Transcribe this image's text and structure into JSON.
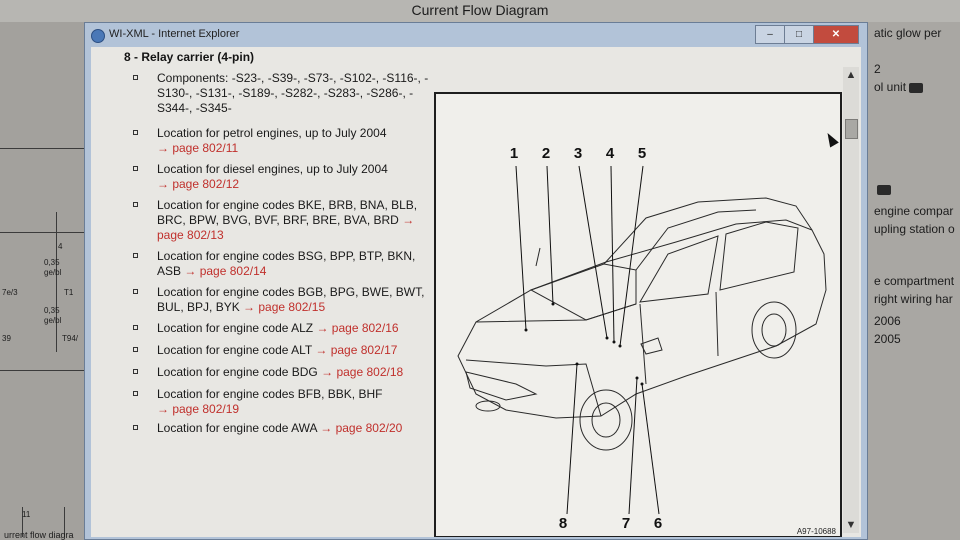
{
  "background_app": {
    "title": "Current Flow Diagram",
    "right_texts": [
      "atic glow per",
      "2",
      "ol unit",
      "engine compar",
      "upling station o",
      "e compartment",
      "right wiring har",
      "2006",
      "2005"
    ],
    "left_texts": [
      "4",
      "0,35",
      "ge/bl",
      "T1",
      "0,35",
      "ge/bl",
      "T94/",
      "7e/3",
      "39",
      "11",
      "urrent flow diagra"
    ]
  },
  "window": {
    "title": "WI-XML - Internet Explorer",
    "controls": {
      "minimize": "–",
      "maximize": "□",
      "close": "✕"
    }
  },
  "doc": {
    "heading": "8 - Relay carrier (4-pin)",
    "items": [
      {
        "text": "Components: -S23-, -S39-, -S73-, -S102-, -S116-, -S130-, -S131-, -S189-, -S282-, -S283-, -S286-, -S344-, -S345-",
        "link": ""
      },
      {
        "text": "Location for petrol engines, up to July 2004",
        "link": "→ page 802/11"
      },
      {
        "text": "Location for diesel engines, up to July 2004",
        "link": "→ page 802/12"
      },
      {
        "text": "Location for engine codes BKE, BRB, BNA, BLB, BRC, BPW, BVG, BVF, BRF, BRE, BVA, BRD",
        "link": "→ page 802/13"
      },
      {
        "text": "Location for engine codes BSG, BPP, BTP, BKN, ASB",
        "link": "→ page 802/14"
      },
      {
        "text": "Location for engine codes BGB, BPG, BWE, BWT, BUL, BPJ, BYK",
        "link": "→ page 802/15"
      },
      {
        "text": "Location for engine code ALZ",
        "link": "→ page 802/16"
      },
      {
        "text": "Location for engine code ALT",
        "link": "→ page 802/17"
      },
      {
        "text": "Location for engine code BDG",
        "link": "→ page 802/18"
      },
      {
        "text": "Location for engine codes BFB, BBK, BHF",
        "link": "→ page 802/19"
      },
      {
        "text": "Location for engine code AWA",
        "link": "→ page 802/20"
      }
    ]
  },
  "figure": {
    "callouts_top": [
      "1",
      "2",
      "3",
      "4",
      "5"
    ],
    "callouts_bottom": [
      "8",
      "7",
      "6"
    ],
    "code": "A97-10688"
  },
  "scrollbar": {
    "up": "▲",
    "down": "▼"
  },
  "colors": {
    "link": "#c0302c",
    "window_frame": "#b2c3d8",
    "close_button": "#c24b3e"
  }
}
